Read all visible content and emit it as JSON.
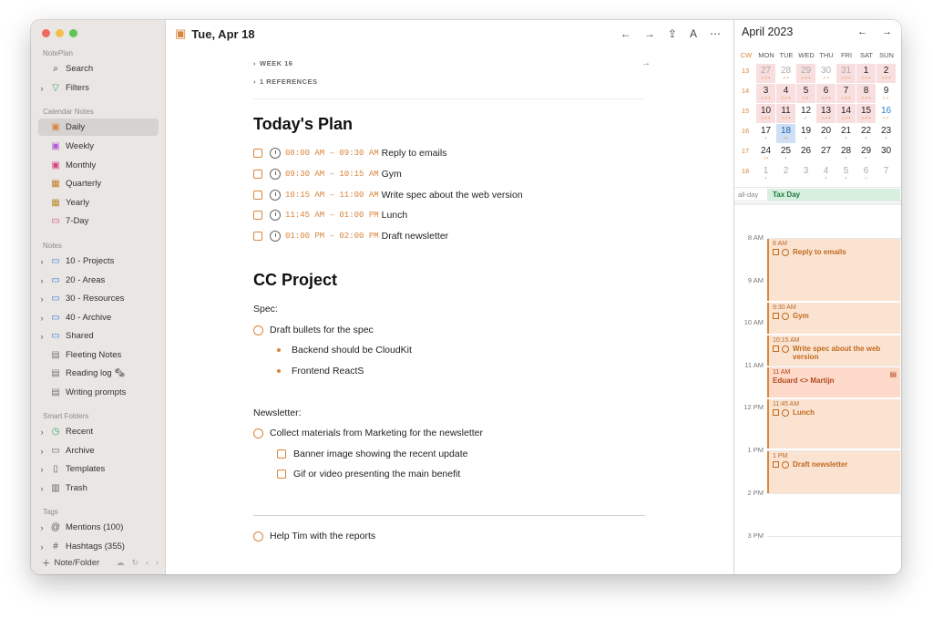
{
  "sidebar": {
    "app_section": "NotePlan",
    "search": "Search",
    "filters": "Filters",
    "calendar_section": "Calendar Notes",
    "calendar_items": [
      "Daily",
      "Weekly",
      "Monthly",
      "Quarterly",
      "Yearly",
      "7-Day"
    ],
    "notes_section": "Notes",
    "note_folders": [
      "10 - Projects",
      "20 - Areas",
      "30 - Resources",
      "40 - Archive",
      "Shared"
    ],
    "note_files": [
      "Fleeting Notes",
      "Reading log 🗞",
      "Writing prompts"
    ],
    "smart_section": "Smart Folders",
    "smart_items": [
      "Recent",
      "Archive",
      "Templates",
      "Trash"
    ],
    "tags_section": "Tags",
    "tags": [
      "Mentions (100)",
      "Hashtags (355)"
    ],
    "new_button": "Note/Folder"
  },
  "editor": {
    "date_title": "Tue, Apr 18",
    "week_label": "WEEK 16",
    "references_label": "1 REFERENCES",
    "plan_heading": "Today's Plan",
    "plan_tasks": [
      {
        "time": "08:00 AM – 09:30 AM",
        "text": "Reply to emails"
      },
      {
        "time": "09:30 AM – 10:15 AM",
        "text": "Gym"
      },
      {
        "time": "10:15 AM – 11:00 AM",
        "text": "Write spec about the web version"
      },
      {
        "time": "11:45 AM – 01:00 PM",
        "text": "Lunch"
      },
      {
        "time": "01:00 PM – 02:00 PM",
        "text": "Draft newsletter"
      }
    ],
    "project_heading": "CC Project",
    "spec_label": "Spec:",
    "spec_task": "Draft bullets for the spec",
    "spec_bullets": [
      "Backend should be CloudKit",
      "Frontend ReactS"
    ],
    "newsletter_label": "Newsletter:",
    "newsletter_task": "Collect materials from Marketing for the newsletter",
    "newsletter_subtasks": [
      "Banner image showing the recent update",
      "Gif or video presenting the main benefit"
    ],
    "final_task": "Help Tim with the reports"
  },
  "calendar": {
    "month": "April 2023",
    "weekday_headers": [
      "CW",
      "MON",
      "TUE",
      "WED",
      "THU",
      "FRI",
      "SAT",
      "SUN"
    ],
    "weeks": [
      {
        "cw": "13",
        "days": [
          "27",
          "28",
          "29",
          "30",
          "31",
          "1",
          "2"
        ]
      },
      {
        "cw": "14",
        "days": [
          "3",
          "4",
          "5",
          "6",
          "7",
          "8",
          "9"
        ]
      },
      {
        "cw": "15",
        "days": [
          "10",
          "11",
          "12",
          "13",
          "14",
          "15",
          "16"
        ]
      },
      {
        "cw": "16",
        "days": [
          "17",
          "18",
          "19",
          "20",
          "21",
          "22",
          "23"
        ]
      },
      {
        "cw": "17",
        "days": [
          "24",
          "25",
          "26",
          "27",
          "28",
          "29",
          "30"
        ]
      },
      {
        "cw": "18",
        "days": [
          "1",
          "2",
          "3",
          "4",
          "5",
          "6",
          "7"
        ]
      }
    ],
    "allday_label": "all-day",
    "allday_event": "Tax Day",
    "hours": [
      "8 AM",
      "9 AM",
      "10 AM",
      "11 AM",
      "12 PM",
      "1 PM",
      "2 PM",
      "3 PM"
    ],
    "events": [
      {
        "time": "8 AM",
        "title": "Reply to emails"
      },
      {
        "time": "9:30 AM",
        "title": "Gym"
      },
      {
        "time": "10:15 AM",
        "title": "Write spec about the web version"
      },
      {
        "time": "11 AM",
        "title": "Eduard <> Martijn"
      },
      {
        "time": "11:45 AM",
        "title": "Lunch"
      },
      {
        "time": "1 PM",
        "title": "Draft newsletter"
      }
    ]
  },
  "colors": {
    "accent": "#d9853b",
    "today": "#cfe0f6",
    "holiday": "#d7efde"
  }
}
